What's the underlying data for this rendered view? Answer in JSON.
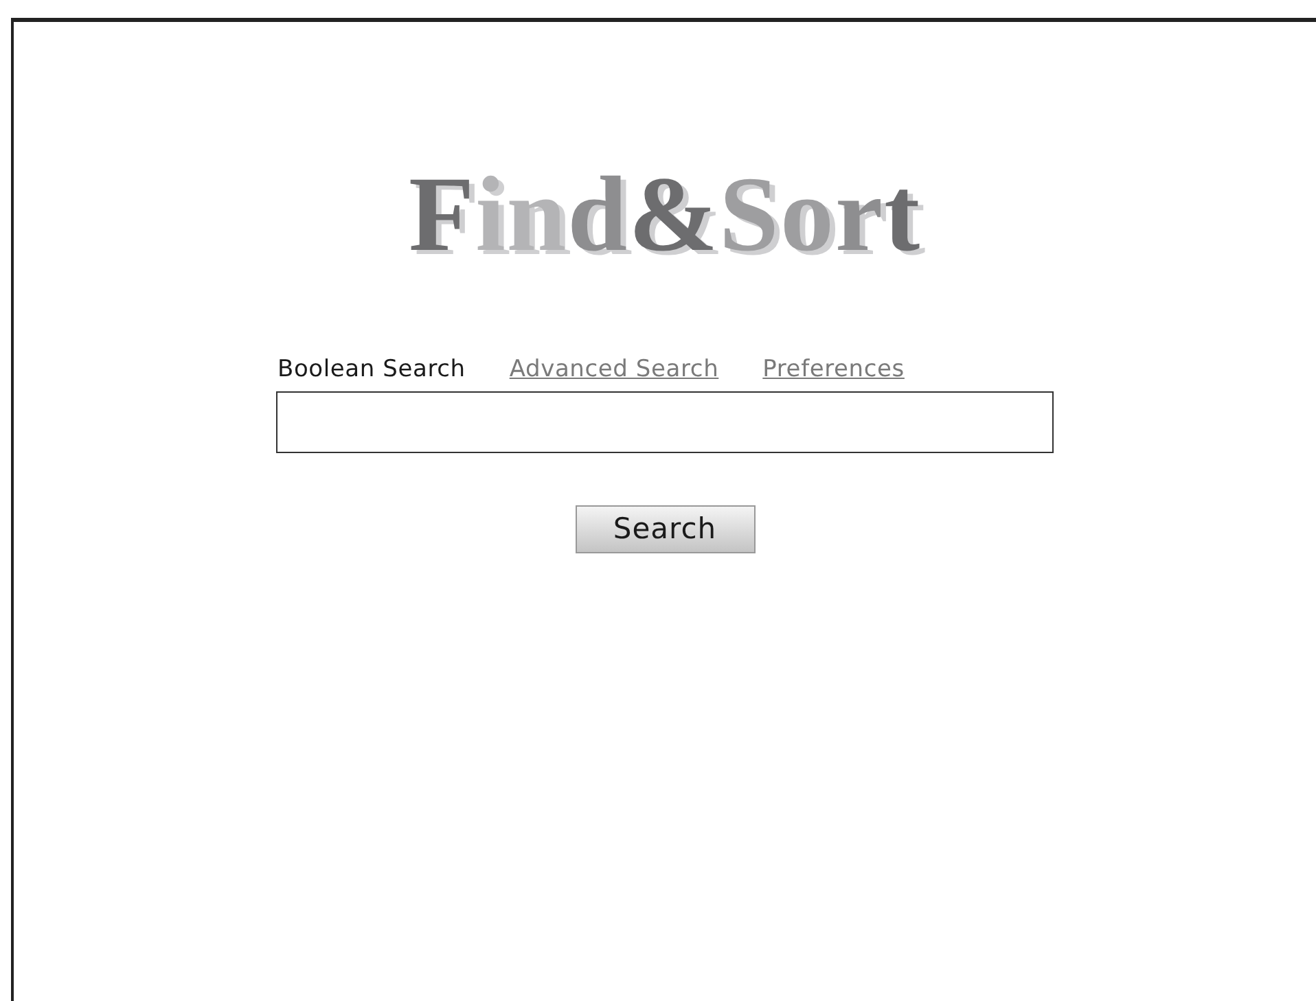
{
  "logo": {
    "letters": [
      {
        "text": "F",
        "color": "#6d6d6f"
      },
      {
        "text": "i",
        "color": "#b4b4b6"
      },
      {
        "text": "n",
        "color": "#b4b4b6"
      },
      {
        "text": "d",
        "color": "#8e8e90"
      },
      {
        "text": "&",
        "color": "#6d6d6f"
      },
      {
        "text": "S",
        "color": "#9e9ea0"
      },
      {
        "text": "o",
        "color": "#9e9ea0"
      },
      {
        "text": "r",
        "color": "#8e8e90"
      },
      {
        "text": "t",
        "color": "#6d6d6f"
      }
    ]
  },
  "tabs": [
    {
      "label": "Boolean Search",
      "selected": true
    },
    {
      "label": "Advanced Search",
      "selected": false
    },
    {
      "label": "Preferences",
      "selected": false
    }
  ],
  "search_button": {
    "label": "Search"
  }
}
